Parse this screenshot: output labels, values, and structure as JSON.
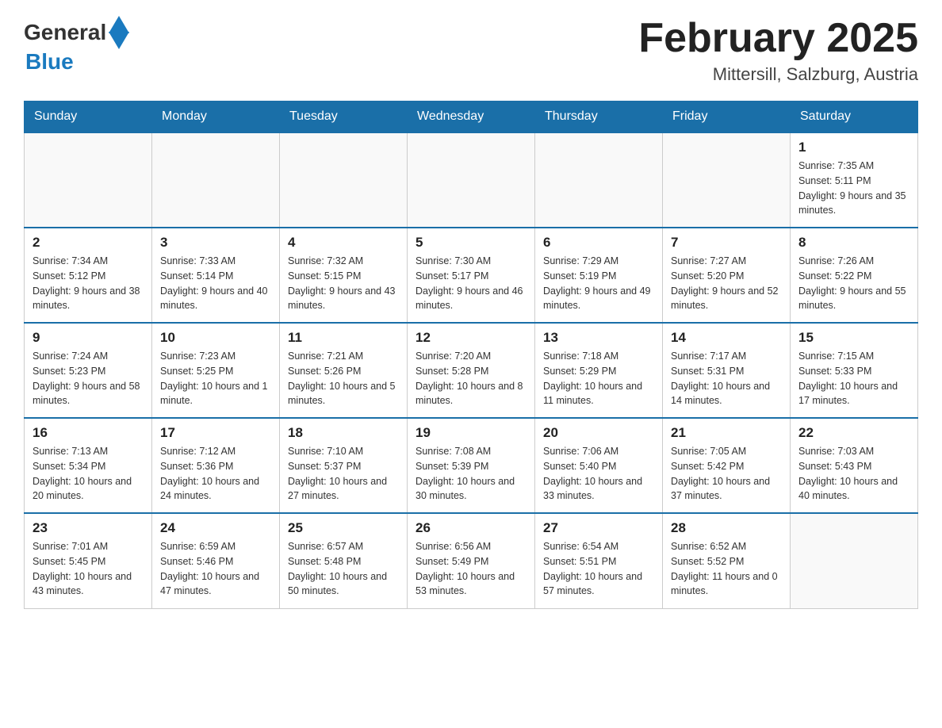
{
  "header": {
    "logo_general": "General",
    "logo_blue": "Blue",
    "month_title": "February 2025",
    "location": "Mittersill, Salzburg, Austria"
  },
  "weekdays": [
    "Sunday",
    "Monday",
    "Tuesday",
    "Wednesday",
    "Thursday",
    "Friday",
    "Saturday"
  ],
  "weeks": [
    [
      {
        "day": "",
        "info": ""
      },
      {
        "day": "",
        "info": ""
      },
      {
        "day": "",
        "info": ""
      },
      {
        "day": "",
        "info": ""
      },
      {
        "day": "",
        "info": ""
      },
      {
        "day": "",
        "info": ""
      },
      {
        "day": "1",
        "info": "Sunrise: 7:35 AM\nSunset: 5:11 PM\nDaylight: 9 hours and 35 minutes."
      }
    ],
    [
      {
        "day": "2",
        "info": "Sunrise: 7:34 AM\nSunset: 5:12 PM\nDaylight: 9 hours and 38 minutes."
      },
      {
        "day": "3",
        "info": "Sunrise: 7:33 AM\nSunset: 5:14 PM\nDaylight: 9 hours and 40 minutes."
      },
      {
        "day": "4",
        "info": "Sunrise: 7:32 AM\nSunset: 5:15 PM\nDaylight: 9 hours and 43 minutes."
      },
      {
        "day": "5",
        "info": "Sunrise: 7:30 AM\nSunset: 5:17 PM\nDaylight: 9 hours and 46 minutes."
      },
      {
        "day": "6",
        "info": "Sunrise: 7:29 AM\nSunset: 5:19 PM\nDaylight: 9 hours and 49 minutes."
      },
      {
        "day": "7",
        "info": "Sunrise: 7:27 AM\nSunset: 5:20 PM\nDaylight: 9 hours and 52 minutes."
      },
      {
        "day": "8",
        "info": "Sunrise: 7:26 AM\nSunset: 5:22 PM\nDaylight: 9 hours and 55 minutes."
      }
    ],
    [
      {
        "day": "9",
        "info": "Sunrise: 7:24 AM\nSunset: 5:23 PM\nDaylight: 9 hours and 58 minutes."
      },
      {
        "day": "10",
        "info": "Sunrise: 7:23 AM\nSunset: 5:25 PM\nDaylight: 10 hours and 1 minute."
      },
      {
        "day": "11",
        "info": "Sunrise: 7:21 AM\nSunset: 5:26 PM\nDaylight: 10 hours and 5 minutes."
      },
      {
        "day": "12",
        "info": "Sunrise: 7:20 AM\nSunset: 5:28 PM\nDaylight: 10 hours and 8 minutes."
      },
      {
        "day": "13",
        "info": "Sunrise: 7:18 AM\nSunset: 5:29 PM\nDaylight: 10 hours and 11 minutes."
      },
      {
        "day": "14",
        "info": "Sunrise: 7:17 AM\nSunset: 5:31 PM\nDaylight: 10 hours and 14 minutes."
      },
      {
        "day": "15",
        "info": "Sunrise: 7:15 AM\nSunset: 5:33 PM\nDaylight: 10 hours and 17 minutes."
      }
    ],
    [
      {
        "day": "16",
        "info": "Sunrise: 7:13 AM\nSunset: 5:34 PM\nDaylight: 10 hours and 20 minutes."
      },
      {
        "day": "17",
        "info": "Sunrise: 7:12 AM\nSunset: 5:36 PM\nDaylight: 10 hours and 24 minutes."
      },
      {
        "day": "18",
        "info": "Sunrise: 7:10 AM\nSunset: 5:37 PM\nDaylight: 10 hours and 27 minutes."
      },
      {
        "day": "19",
        "info": "Sunrise: 7:08 AM\nSunset: 5:39 PM\nDaylight: 10 hours and 30 minutes."
      },
      {
        "day": "20",
        "info": "Sunrise: 7:06 AM\nSunset: 5:40 PM\nDaylight: 10 hours and 33 minutes."
      },
      {
        "day": "21",
        "info": "Sunrise: 7:05 AM\nSunset: 5:42 PM\nDaylight: 10 hours and 37 minutes."
      },
      {
        "day": "22",
        "info": "Sunrise: 7:03 AM\nSunset: 5:43 PM\nDaylight: 10 hours and 40 minutes."
      }
    ],
    [
      {
        "day": "23",
        "info": "Sunrise: 7:01 AM\nSunset: 5:45 PM\nDaylight: 10 hours and 43 minutes."
      },
      {
        "day": "24",
        "info": "Sunrise: 6:59 AM\nSunset: 5:46 PM\nDaylight: 10 hours and 47 minutes."
      },
      {
        "day": "25",
        "info": "Sunrise: 6:57 AM\nSunset: 5:48 PM\nDaylight: 10 hours and 50 minutes."
      },
      {
        "day": "26",
        "info": "Sunrise: 6:56 AM\nSunset: 5:49 PM\nDaylight: 10 hours and 53 minutes."
      },
      {
        "day": "27",
        "info": "Sunrise: 6:54 AM\nSunset: 5:51 PM\nDaylight: 10 hours and 57 minutes."
      },
      {
        "day": "28",
        "info": "Sunrise: 6:52 AM\nSunset: 5:52 PM\nDaylight: 11 hours and 0 minutes."
      },
      {
        "day": "",
        "info": ""
      }
    ]
  ]
}
